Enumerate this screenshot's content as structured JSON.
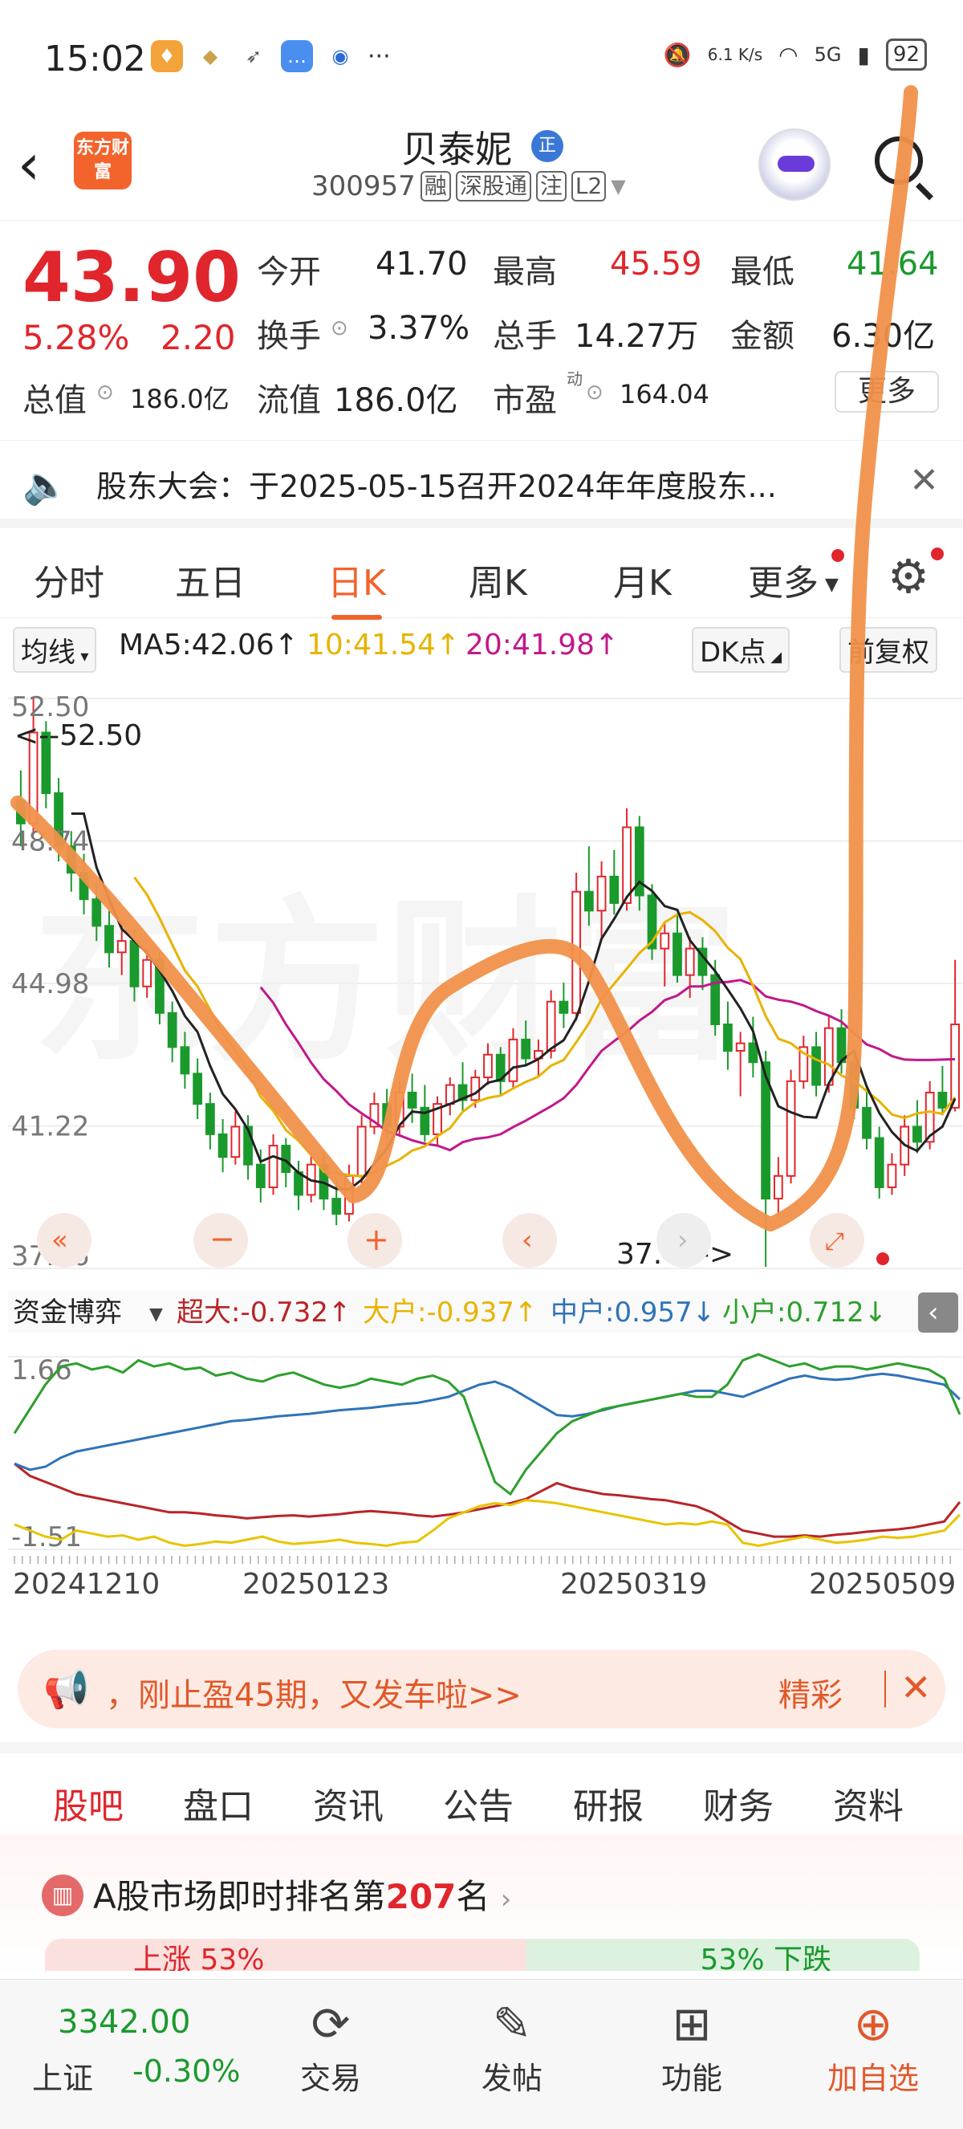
{
  "status": {
    "time": "15:02",
    "speed": "6.1 K/s",
    "network": "5G",
    "battery": "92"
  },
  "header": {
    "logo": "东方财富",
    "stock_name": "贝泰妮",
    "stock_code": "300957",
    "tags": [
      "融",
      "深股通",
      "注",
      "L2"
    ]
  },
  "quote": {
    "price": "43.90",
    "change_pct": "5.28%",
    "change": "2.20",
    "open_label": "今开",
    "open": "41.70",
    "high_label": "最高",
    "high": "45.59",
    "low_label": "最低",
    "low": "41.64",
    "turnover_label": "换手",
    "turnover": "3.37%",
    "volume_label": "总手",
    "volume": "14.27万",
    "amount_label": "金额",
    "amount": "6.30亿",
    "mktcap_label": "总值",
    "mktcap": "186.0亿",
    "float_label": "流值",
    "float": "186.0亿",
    "pe_label": "市盈",
    "pe_sup": "动",
    "pe": "164.04",
    "more_label": "更多"
  },
  "notice": {
    "text": "股东大会：于2025-05-15召开2024年年度股东..."
  },
  "tabs": [
    "分时",
    "五日",
    "日K",
    "周K",
    "月K",
    "更多"
  ],
  "indicators": {
    "ma_selector": "均线",
    "ma5": "MA5:42.06↑",
    "ma10": "10:41.54↑",
    "ma20": "20:41.98↑",
    "dk_button": "DK点",
    "adjust_button": "前复权"
  },
  "colors": {
    "up": "#e0262c",
    "down": "#1a9a2d",
    "accent": "#f3632c",
    "ma5": "#222222",
    "ma10": "#e8b300",
    "ma20": "#c2188a"
  },
  "chart_data": [
    {
      "type": "candlestick",
      "title": "",
      "y_ticks": [
        "52.50",
        "48.74",
        "44.98",
        "41.22",
        "37.46"
      ],
      "ylim": [
        37.46,
        52.5
      ],
      "max_label": "<--52.50",
      "min_label": "37.46->",
      "ohlc": [
        [
          49.8,
          50.6,
          48.6,
          49.2
        ],
        [
          49.2,
          52.5,
          48.9,
          51.6
        ],
        [
          51.6,
          51.9,
          49.6,
          50.0
        ],
        [
          50.0,
          50.4,
          48.2,
          48.6
        ],
        [
          48.6,
          49.0,
          47.4,
          47.9
        ],
        [
          47.9,
          48.4,
          46.8,
          47.2
        ],
        [
          47.2,
          47.6,
          46.1,
          46.5
        ],
        [
          46.5,
          46.9,
          45.4,
          45.8
        ],
        [
          45.8,
          46.6,
          45.2,
          46.1
        ],
        [
          46.1,
          46.4,
          44.5,
          44.9
        ],
        [
          44.9,
          45.9,
          44.6,
          45.6
        ],
        [
          45.6,
          45.8,
          43.9,
          44.2
        ],
        [
          44.2,
          44.5,
          42.9,
          43.3
        ],
        [
          43.3,
          43.7,
          42.2,
          42.6
        ],
        [
          42.6,
          43.0,
          41.4,
          41.8
        ],
        [
          41.8,
          42.1,
          40.6,
          41.0
        ],
        [
          41.0,
          41.4,
          40.0,
          40.4
        ],
        [
          40.4,
          41.6,
          40.2,
          41.2
        ],
        [
          41.2,
          41.5,
          39.8,
          40.2
        ],
        [
          40.2,
          40.6,
          39.2,
          39.6
        ],
        [
          39.6,
          41.0,
          39.4,
          40.7
        ],
        [
          40.7,
          40.9,
          39.6,
          40.0
        ],
        [
          40.0,
          40.3,
          39.0,
          39.4
        ],
        [
          39.4,
          40.5,
          39.2,
          40.2
        ],
        [
          40.2,
          40.5,
          39.0,
          39.3
        ],
        [
          39.3,
          39.8,
          38.6,
          38.9
        ],
        [
          38.9,
          40.2,
          38.7,
          39.9
        ],
        [
          39.9,
          41.5,
          39.7,
          41.2
        ],
        [
          41.2,
          42.1,
          41.0,
          41.8
        ],
        [
          41.8,
          42.2,
          40.9,
          41.2
        ],
        [
          41.2,
          42.4,
          41.0,
          42.1
        ],
        [
          42.1,
          42.6,
          41.3,
          41.7
        ],
        [
          41.7,
          42.3,
          40.8,
          41.0
        ],
        [
          41.0,
          42.0,
          40.7,
          41.8
        ],
        [
          41.8,
          42.5,
          41.5,
          42.3
        ],
        [
          42.3,
          42.9,
          41.6,
          41.9
        ],
        [
          41.9,
          42.7,
          41.7,
          42.5
        ],
        [
          42.5,
          43.4,
          42.3,
          43.1
        ],
        [
          43.1,
          43.3,
          42.0,
          42.4
        ],
        [
          42.4,
          43.8,
          42.2,
          43.5
        ],
        [
          43.5,
          44.0,
          42.8,
          43.0
        ],
        [
          43.0,
          43.5,
          42.5,
          43.2
        ],
        [
          43.2,
          44.8,
          43.0,
          44.5
        ],
        [
          44.5,
          45.0,
          43.8,
          44.2
        ],
        [
          44.2,
          47.9,
          44.0,
          47.4
        ],
        [
          47.4,
          48.6,
          46.5,
          46.9
        ],
        [
          46.9,
          48.2,
          46.2,
          47.8
        ],
        [
          47.8,
          48.5,
          46.8,
          47.1
        ],
        [
          47.1,
          49.6,
          46.9,
          49.1
        ],
        [
          49.1,
          49.4,
          46.9,
          47.3
        ],
        [
          47.3,
          47.6,
          45.6,
          45.9
        ],
        [
          45.9,
          46.6,
          44.9,
          46.3
        ],
        [
          46.3,
          46.8,
          45.0,
          45.2
        ],
        [
          45.2,
          46.2,
          44.6,
          45.9
        ],
        [
          45.9,
          46.2,
          44.8,
          45.2
        ],
        [
          45.2,
          45.6,
          43.6,
          43.9
        ],
        [
          43.9,
          44.5,
          42.7,
          43.2
        ],
        [
          43.2,
          43.7,
          42.0,
          43.4
        ],
        [
          43.4,
          44.1,
          42.5,
          42.9
        ],
        [
          42.9,
          43.2,
          37.5,
          39.3
        ],
        [
          39.3,
          40.4,
          38.8,
          39.9
        ],
        [
          39.9,
          42.7,
          39.7,
          42.4
        ],
        [
          42.4,
          43.6,
          42.2,
          43.3
        ],
        [
          43.3,
          43.7,
          42.0,
          42.3
        ],
        [
          42.3,
          44.1,
          42.1,
          43.8
        ],
        [
          43.8,
          44.3,
          42.6,
          42.9
        ],
        [
          42.9,
          43.2,
          41.4,
          41.7
        ],
        [
          41.7,
          42.2,
          40.6,
          40.9
        ],
        [
          40.9,
          41.2,
          39.3,
          39.6
        ],
        [
          39.6,
          40.5,
          39.4,
          40.2
        ],
        [
          40.2,
          41.5,
          39.9,
          41.2
        ],
        [
          41.2,
          41.9,
          40.5,
          40.8
        ],
        [
          40.8,
          42.4,
          40.6,
          42.1
        ],
        [
          42.1,
          42.8,
          41.5,
          41.7
        ],
        [
          41.7,
          45.6,
          41.6,
          43.9
        ]
      ],
      "ma5": [
        null,
        null,
        null,
        null,
        49.46,
        49.46,
        48.04,
        47.2,
        46.42,
        46.1,
        45.78,
        45.32,
        44.78,
        44.12,
        43.7,
        42.8,
        42.06,
        41.66,
        41.12,
        40.28,
        40.42,
        40.3,
        39.98,
        39.78,
        39.72,
        39.56,
        39.54,
        39.8,
        40.22,
        40.62,
        41.24,
        41.6,
        41.56,
        41.68,
        41.8,
        41.94,
        42.08,
        42.36,
        42.44,
        42.76,
        42.82,
        42.98,
        43.26,
        43.48,
        44.06,
        45.04,
        46.16,
        46.68,
        47.26,
        47.66,
        47.42,
        47.02,
        46.92,
        46.12,
        45.7,
        45.3,
        44.82,
        44.32,
        43.72,
        42.54,
        41.74,
        41.58,
        41.46,
        41.44,
        42.34,
        42.94,
        43.2,
        42.26,
        41.56,
        41.06,
        40.72,
        40.56,
        40.96,
        41.2,
        41.94
      ],
      "ma10": [
        null,
        null,
        null,
        null,
        null,
        null,
        null,
        null,
        null,
        47.78,
        47.32,
        46.7,
        46.0,
        45.32,
        44.9,
        44.28,
        43.66,
        43.22,
        42.66,
        41.99,
        41.62,
        41.11,
        40.83,
        40.45,
        40.01,
        39.98,
        39.92,
        39.89,
        40.0,
        40.17,
        40.33,
        40.57,
        40.68,
        40.95,
        41.16,
        41.59,
        41.84,
        41.96,
        42.02,
        42.21,
        42.38,
        42.52,
        42.81,
        42.96,
        43.43,
        43.93,
        44.57,
        44.97,
        45.37,
        45.78,
        46.08,
        46.59,
        46.8,
        46.86,
        46.65,
        46.36,
        45.92,
        45.62,
        44.92,
        44.12,
        43.52,
        43.4,
        43.14,
        42.97,
        42.84,
        42.55,
        42.41,
        42.14,
        41.87,
        41.52,
        41.43,
        41.55,
        41.6,
        41.54,
        41.98
      ],
      "ma20": [
        null,
        null,
        null,
        null,
        null,
        null,
        null,
        null,
        null,
        null,
        null,
        null,
        null,
        null,
        null,
        null,
        null,
        null,
        null,
        44.88,
        44.47,
        43.9,
        43.41,
        42.89,
        42.45,
        42.14,
        41.79,
        41.55,
        41.33,
        41.08,
        40.97,
        40.84,
        40.75,
        40.7,
        40.58,
        40.79,
        40.88,
        40.92,
        41.0,
        41.19,
        41.36,
        41.55,
        41.74,
        41.95,
        42.3,
        42.76,
        43.2,
        43.46,
        43.7,
        44.0,
        44.23,
        44.54,
        44.66,
        44.9,
        44.9,
        45.0,
        45.02,
        45.07,
        44.94,
        44.64,
        44.55,
        44.5,
        44.4,
        44.25,
        44.13,
        43.97,
        43.66,
        43.37,
        43.25,
        43.06,
        42.97,
        42.96,
        42.96,
        42.97,
        42.98
      ]
    },
    {
      "type": "line",
      "title": "资金博弈",
      "y_ticks": [
        "1.66",
        "-1.51"
      ],
      "ylim": [
        -1.51,
        1.66
      ],
      "x_ticks": [
        "20241210",
        "20250123",
        "20250319",
        "20250509"
      ],
      "series": [
        {
          "name": "超大",
          "label": "超大:-0.732↑",
          "color": "#b82428",
          "values": [
            -0.1,
            -0.3,
            -0.4,
            -0.5,
            -0.6,
            -0.65,
            -0.7,
            -0.75,
            -0.8,
            -0.85,
            -0.9,
            -0.9,
            -0.92,
            -0.95,
            -0.97,
            -1.0,
            -0.98,
            -0.96,
            -0.95,
            -0.97,
            -0.95,
            -0.93,
            -0.9,
            -0.88,
            -0.9,
            -0.92,
            -0.95,
            -0.97,
            -0.94,
            -0.9,
            -0.85,
            -0.8,
            -0.75,
            -0.68,
            -0.55,
            -0.42,
            -0.5,
            -0.55,
            -0.6,
            -0.62,
            -0.65,
            -0.68,
            -0.7,
            -0.75,
            -0.8,
            -0.9,
            -1.05,
            -1.2,
            -1.25,
            -1.3,
            -1.3,
            -1.28,
            -1.3,
            -1.27,
            -1.25,
            -1.22,
            -1.2,
            -1.18,
            -1.15,
            -1.1,
            -1.05,
            -0.73
          ]
        },
        {
          "name": "大户",
          "label": "大户:-0.937↑",
          "color": "#e8c400",
          "values": [
            -1.1,
            -1.2,
            -1.3,
            -1.35,
            -1.2,
            -1.25,
            -1.3,
            -1.28,
            -1.35,
            -1.3,
            -1.4,
            -1.45,
            -1.42,
            -1.38,
            -1.4,
            -1.35,
            -1.3,
            -1.38,
            -1.42,
            -1.4,
            -1.38,
            -1.35,
            -1.4,
            -1.42,
            -1.45,
            -1.4,
            -1.38,
            -1.2,
            -1.0,
            -0.9,
            -0.8,
            -0.75,
            -0.78,
            -0.7,
            -0.72,
            -0.75,
            -0.8,
            -0.85,
            -0.9,
            -0.95,
            -1.0,
            -1.05,
            -1.1,
            -1.08,
            -1.1,
            -1.05,
            -1.1,
            -1.4,
            -1.45,
            -1.4,
            -1.35,
            -1.3,
            -1.35,
            -1.4,
            -1.38,
            -1.35,
            -1.3,
            -1.32,
            -1.3,
            -1.25,
            -1.2,
            -0.94
          ]
        },
        {
          "name": "中户",
          "label": "中户:0.957↓",
          "color": "#2f73b8",
          "values": [
            -0.1,
            -0.2,
            -0.15,
            0.0,
            0.1,
            0.15,
            0.2,
            0.25,
            0.3,
            0.35,
            0.4,
            0.45,
            0.5,
            0.55,
            0.6,
            0.62,
            0.65,
            0.68,
            0.7,
            0.72,
            0.75,
            0.78,
            0.8,
            0.82,
            0.85,
            0.88,
            0.9,
            0.95,
            1.0,
            1.1,
            1.2,
            1.25,
            1.15,
            1.0,
            0.85,
            0.7,
            0.68,
            0.72,
            0.78,
            0.85,
            0.9,
            0.95,
            1.0,
            1.05,
            1.1,
            1.1,
            1.05,
            1.0,
            1.1,
            1.2,
            1.3,
            1.35,
            1.3,
            1.28,
            1.3,
            1.35,
            1.38,
            1.35,
            1.3,
            1.25,
            1.2,
            0.96
          ]
        },
        {
          "name": "小户",
          "label": "小户:0.712↓",
          "color": "#2ca02c",
          "values": [
            0.4,
            0.8,
            1.2,
            1.5,
            1.55,
            1.45,
            1.5,
            1.4,
            1.6,
            1.5,
            1.55,
            1.45,
            1.48,
            1.35,
            1.4,
            1.3,
            1.25,
            1.35,
            1.4,
            1.3,
            1.2,
            1.15,
            1.2,
            1.3,
            1.25,
            1.2,
            1.3,
            1.35,
            1.25,
            1.0,
            0.3,
            -0.4,
            -0.6,
            -0.2,
            0.1,
            0.4,
            0.6,
            0.7,
            0.8,
            0.85,
            0.9,
            0.95,
            1.0,
            1.05,
            1.0,
            1.0,
            1.2,
            1.6,
            1.7,
            1.6,
            1.5,
            1.55,
            1.45,
            1.5,
            1.5,
            1.45,
            1.5,
            1.55,
            1.5,
            1.45,
            1.3,
            0.71
          ]
        }
      ]
    }
  ],
  "ad": {
    "text": "，刚止盈45期，又发车啦>>",
    "right": "精彩"
  },
  "sub_tabs": [
    "股吧",
    "盘口",
    "资讯",
    "公告",
    "研报",
    "财务",
    "资料"
  ],
  "rank": {
    "prefix": "A股市场即时排名第",
    "number": "207",
    "suffix": "名",
    "rise": "上涨 53%",
    "fall": "53% 下跌"
  },
  "bottom_nav": {
    "index_value": "3342.00",
    "index_name": "上证",
    "index_pct": "-0.30%",
    "items": [
      "交易",
      "发帖",
      "功能",
      "加自选"
    ]
  }
}
